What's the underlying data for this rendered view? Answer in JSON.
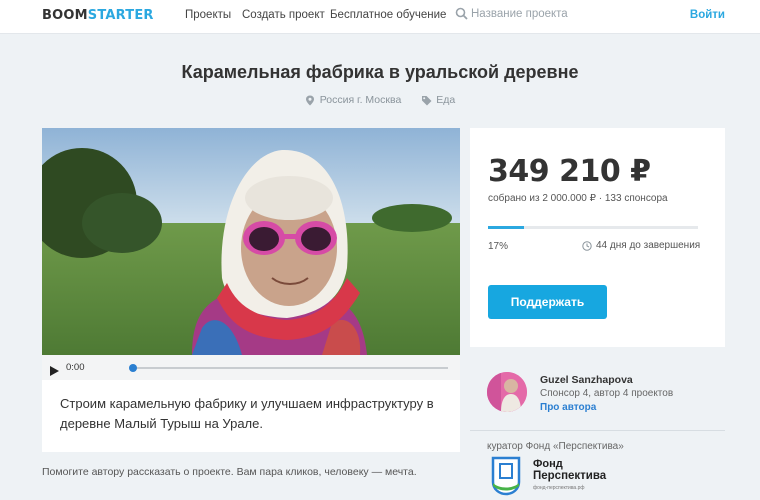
{
  "header": {
    "logo_part1": "BOOM",
    "logo_part2": "STARTER",
    "nav": [
      "Проекты",
      "Создать проект",
      "Бесплатное обучение"
    ],
    "search_placeholder": "Название проекта",
    "search_icon": "search-icon",
    "login": "Войти"
  },
  "project": {
    "title": "Карамельная фабрика в уральской деревне",
    "location": "Россия г. Москва",
    "category": "Еда",
    "description": "Строим карамельную фабрику и улучшаем инфраструктуру в деревне Малый Турыш на Урале.",
    "help_text": "Помогите автору рассказать о проекте. Вам пара кликов, человеку — мечта."
  },
  "player": {
    "time": "0:00",
    "progress": 0
  },
  "stats": {
    "amount": "349 210 ₽",
    "collected": "собрано из 2 000.000 ₽ · 133 спонсора",
    "percent": "17%",
    "percent_value": 17,
    "days_left": "44 дня до завершения",
    "support_button": "Поддержать"
  },
  "author": {
    "name": "Guzel Sanzhapova",
    "info": "Спонсор 4, автор 4 проектов",
    "link": "Про автора"
  },
  "curator": {
    "label": "куратор Фонд «Перспектива»",
    "fund_line1": "Фонд",
    "fund_line2": "Перспектива",
    "fund_site": "фонд-перспектива.рф"
  },
  "colors": {
    "accent": "#17a7e0",
    "link": "#2b7fd1",
    "background": "#eef2f5"
  }
}
